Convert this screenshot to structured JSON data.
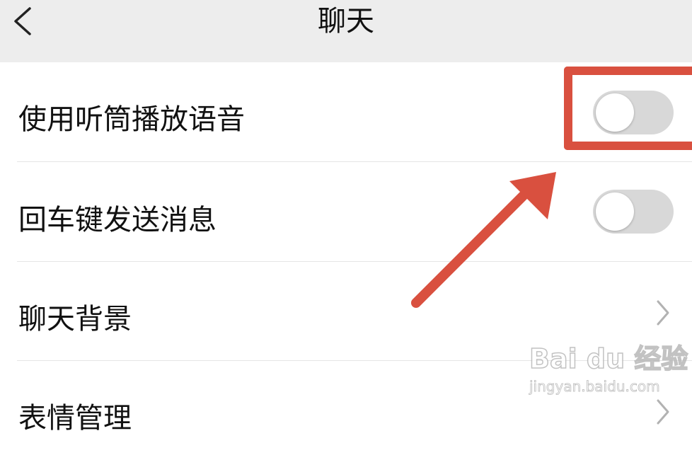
{
  "header": {
    "title": "聊天",
    "back_icon": "chevron-left-icon"
  },
  "settings": [
    {
      "label": "使用听筒播放语音",
      "control": "toggle",
      "enabled": false
    },
    {
      "label": "回车键发送消息",
      "control": "toggle",
      "enabled": false
    },
    {
      "label": "聊天背景",
      "control": "chevron-right-icon"
    },
    {
      "label": "表情管理",
      "control": "chevron-right-icon"
    }
  ],
  "annotation": {
    "color": "#d9503f",
    "type": "highlight-box-with-arrow"
  },
  "watermark": {
    "brand": "Bai du 经验",
    "url": "jingyan.baidu.com"
  },
  "colors": {
    "header_bg": "#ededed",
    "toggle_off": "#d8d8d8",
    "divider": "#e5e5e5"
  }
}
